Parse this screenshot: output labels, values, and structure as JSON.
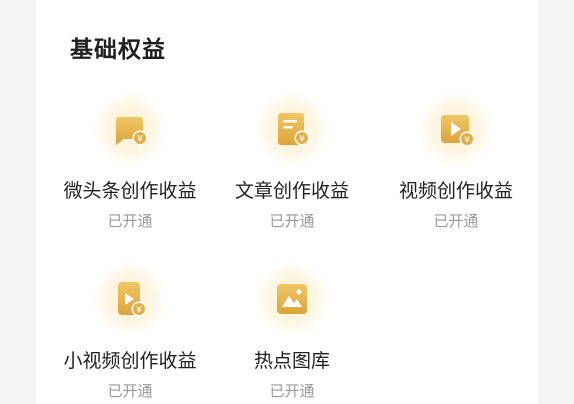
{
  "section": {
    "title": "基础权益"
  },
  "colors": {
    "icon_gold": "#e0ae45",
    "glow": "#fdf1d2",
    "title": "#1f1f1f",
    "status": "#9a9a9a"
  },
  "benefits": [
    {
      "name": "微头条创作收益",
      "status": "已开通",
      "icon": "chat-bubble-coin-icon"
    },
    {
      "name": "文章创作收益",
      "status": "已开通",
      "icon": "document-coin-icon"
    },
    {
      "name": "视频创作收益",
      "status": "已开通",
      "icon": "video-coin-icon"
    },
    {
      "name": "小视频创作收益",
      "status": "已开通",
      "icon": "small-video-coin-icon"
    },
    {
      "name": "热点图库",
      "status": "已开通",
      "icon": "image-gallery-icon"
    }
  ]
}
